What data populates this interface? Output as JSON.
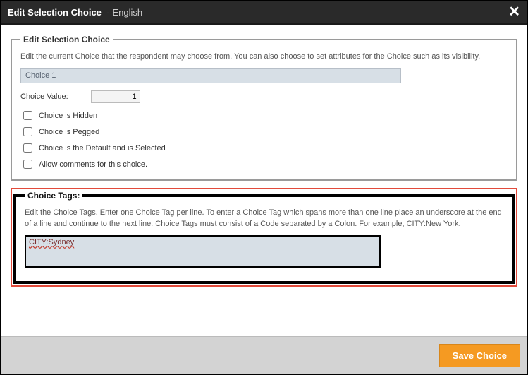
{
  "title": {
    "bold": "Edit Selection Choice",
    "sep": "  -  English"
  },
  "group1": {
    "legend": "Edit Selection Choice",
    "help": "Edit the current Choice that the respondent may choose from. You can also choose to set attributes for the Choice such as its visibility.",
    "choice_name": "Choice 1",
    "value_label": "Choice Value:",
    "value": "1",
    "cb_hidden": "Choice is Hidden",
    "cb_pegged": "Choice is Pegged",
    "cb_default": "Choice is the Default and is Selected",
    "cb_comments": "Allow comments for this choice."
  },
  "group2": {
    "legend": "Choice Tags:",
    "help": "Edit the Choice Tags. Enter one Choice Tag per line. To enter a Choice Tag which spans more than one line place an underscore at the end of a line and continue to the next line. Choice Tags must consist of a Code separated by a Colon. For example, CITY:New York.",
    "tags_value": "CITY:Sydney"
  },
  "footer": {
    "save": "Save Choice"
  }
}
